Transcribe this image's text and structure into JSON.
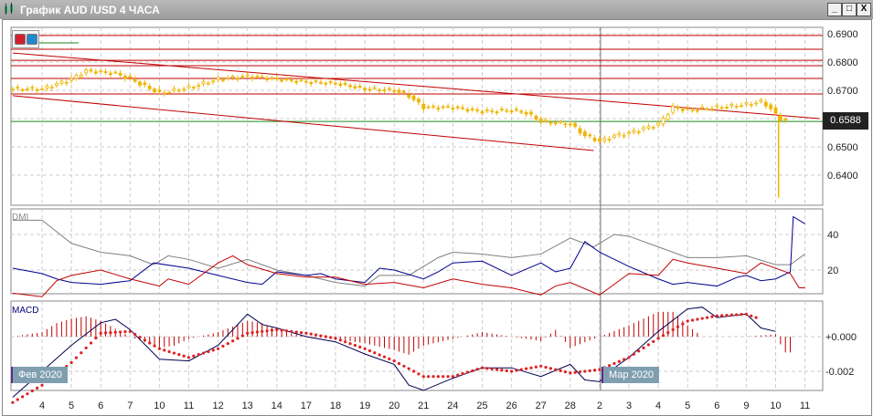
{
  "window": {
    "title": "График AUD /USD  4 ЧАСА",
    "minimize": "_",
    "maximize": "□",
    "close": "X"
  },
  "price_tag": "0.6588",
  "indicators": {
    "dmi": "DMI",
    "macd": "MACD"
  },
  "months": [
    "Фев 2020",
    "Мар 2020"
  ],
  "colors": {
    "candle": "#f0b400",
    "level": "#c00000",
    "green": "#1a8a1a",
    "adx": "#808080",
    "plus_di": "#000090",
    "minus_di": "#c00000",
    "macd": "#000050",
    "signal": "#e02020"
  },
  "chart_data": {
    "type": "line",
    "symbol": "AUD/USD",
    "timeframe": "4 ЧАСА",
    "x_ticks": [
      "4",
      "5",
      "6",
      "7",
      "10",
      "11",
      "12",
      "13",
      "14",
      "17",
      "18",
      "19",
      "20",
      "21",
      "24",
      "25",
      "26",
      "27",
      "28",
      "2",
      "3",
      "4",
      "5",
      "6",
      "9",
      "10",
      "11"
    ],
    "price": {
      "ylim": [
        0.632,
        0.6905
      ],
      "y_ticks": [
        "0.6900",
        "0.6800",
        "0.6700",
        "0.6500",
        "0.6400"
      ],
      "current": 0.6588,
      "close": [
        [
          -1,
          0.6705
        ],
        [
          0,
          0.6705
        ],
        [
          1,
          0.674
        ],
        [
          1.5,
          0.677
        ],
        [
          2,
          0.6765
        ],
        [
          2.5,
          0.676
        ],
        [
          3,
          0.674
        ],
        [
          4,
          0.669
        ],
        [
          4.5,
          0.67
        ],
        [
          5,
          0.671
        ],
        [
          6,
          0.674
        ],
        [
          7,
          0.675
        ],
        [
          8,
          0.674
        ],
        [
          9,
          0.673
        ],
        [
          10,
          0.6725
        ],
        [
          11,
          0.6705
        ],
        [
          12,
          0.67
        ],
        [
          12.5,
          0.668
        ],
        [
          13,
          0.664
        ],
        [
          14,
          0.664
        ],
        [
          15,
          0.6625
        ],
        [
          16,
          0.663
        ],
        [
          16.5,
          0.662
        ],
        [
          17,
          0.659
        ],
        [
          18,
          0.658
        ],
        [
          18.5,
          0.654
        ],
        [
          19,
          0.652
        ],
        [
          19.5,
          0.654
        ],
        [
          20,
          0.655
        ],
        [
          21,
          0.658
        ],
        [
          21.5,
          0.664
        ],
        [
          22,
          0.663
        ],
        [
          23,
          0.664
        ],
        [
          24,
          0.665
        ],
        [
          24.5,
          0.666
        ],
        [
          24.8,
          0.664
        ],
        [
          25.1,
          0.66
        ],
        [
          25.5,
          0.659
        ]
      ],
      "spike_low": [
        25.1,
        0.632
      ],
      "levels": [
        0.6894,
        0.6845,
        0.6806,
        0.6787,
        0.6742,
        0.6687
      ],
      "green_level": 0.659,
      "trendlines": [
        [
          [
            -1,
            0.6832
          ],
          [
            26.5,
            0.66
          ]
        ],
        [
          [
            -1,
            0.6681
          ],
          [
            18.8,
            0.6487
          ]
        ]
      ]
    },
    "dmi": {
      "ylim": [
        4,
        52
      ],
      "y_ticks": [
        "40",
        "20"
      ],
      "adx": [
        [
          -1,
          48
        ],
        [
          0,
          48
        ],
        [
          1,
          35
        ],
        [
          2,
          30
        ],
        [
          3,
          28
        ],
        [
          3.8,
          23
        ],
        [
          4.3,
          28
        ],
        [
          5,
          26
        ],
        [
          6,
          21
        ],
        [
          7,
          26
        ],
        [
          8,
          20
        ],
        [
          9,
          17
        ],
        [
          10,
          13
        ],
        [
          11,
          11
        ],
        [
          11.5,
          17
        ],
        [
          12.5,
          17
        ],
        [
          13.5,
          27
        ],
        [
          14,
          30
        ],
        [
          15,
          29
        ],
        [
          16,
          27
        ],
        [
          17,
          29
        ],
        [
          18,
          38
        ],
        [
          18.8,
          33
        ],
        [
          19.5,
          40
        ],
        [
          20,
          39
        ],
        [
          21,
          33
        ],
        [
          22,
          27
        ],
        [
          23,
          27
        ],
        [
          24,
          28
        ],
        [
          25,
          23
        ],
        [
          25.5,
          23
        ],
        [
          26,
          29
        ]
      ],
      "plus_di": [
        [
          -1,
          21
        ],
        [
          0,
          18
        ],
        [
          0.5,
          15
        ],
        [
          1,
          13
        ],
        [
          2,
          12
        ],
        [
          3,
          14
        ],
        [
          3.8,
          24
        ],
        [
          5,
          21
        ],
        [
          6,
          17
        ],
        [
          7,
          13
        ],
        [
          7.5,
          12
        ],
        [
          8,
          19
        ],
        [
          9,
          17
        ],
        [
          9.5,
          18
        ],
        [
          10,
          15
        ],
        [
          11,
          13
        ],
        [
          11.5,
          21
        ],
        [
          12,
          20
        ],
        [
          13,
          15
        ],
        [
          13.5,
          19
        ],
        [
          14,
          24
        ],
        [
          15,
          25
        ],
        [
          16,
          17
        ],
        [
          17,
          24
        ],
        [
          17.5,
          19
        ],
        [
          18,
          21
        ],
        [
          18.5,
          36
        ],
        [
          19,
          30
        ],
        [
          20,
          22
        ],
        [
          21,
          15
        ],
        [
          21.5,
          12
        ],
        [
          22,
          13
        ],
        [
          23,
          11
        ],
        [
          23.7,
          16
        ],
        [
          24,
          17
        ],
        [
          24.5,
          14
        ],
        [
          25,
          15
        ],
        [
          25.5,
          19
        ],
        [
          25.6,
          50
        ],
        [
          26,
          46
        ]
      ],
      "minus_di": [
        [
          -1,
          7
        ],
        [
          0,
          5
        ],
        [
          0.5,
          14
        ],
        [
          1,
          17
        ],
        [
          2,
          20
        ],
        [
          3,
          15
        ],
        [
          4,
          11
        ],
        [
          4.3,
          15
        ],
        [
          5,
          12
        ],
        [
          6,
          24
        ],
        [
          6.5,
          28
        ],
        [
          7,
          23
        ],
        [
          8,
          18
        ],
        [
          9,
          16
        ],
        [
          10,
          16
        ],
        [
          11,
          12
        ],
        [
          12,
          13
        ],
        [
          13,
          10
        ],
        [
          14,
          15
        ],
        [
          15,
          12
        ],
        [
          16,
          10
        ],
        [
          17,
          6
        ],
        [
          17.5,
          11
        ],
        [
          18,
          13
        ],
        [
          19,
          6
        ],
        [
          19.5,
          12
        ],
        [
          20,
          18
        ],
        [
          21,
          17
        ],
        [
          21.5,
          26
        ],
        [
          22,
          24
        ],
        [
          23,
          21
        ],
        [
          24,
          18
        ],
        [
          24.5,
          24
        ],
        [
          25,
          21
        ],
        [
          25.5,
          18
        ],
        [
          25.8,
          10
        ],
        [
          26,
          10
        ]
      ]
    },
    "macd": {
      "unit": 0.001,
      "ylim": [
        -3.2,
        1.9
      ],
      "y_ticks": [
        "+0.000",
        "-0.002"
      ],
      "main": [
        [
          -1,
          -3.5
        ],
        [
          0,
          -2
        ],
        [
          1,
          -0.5
        ],
        [
          2,
          0.8
        ],
        [
          2.5,
          1
        ],
        [
          3,
          0.4
        ],
        [
          4,
          -1.3
        ],
        [
          5,
          -1.4
        ],
        [
          6,
          -0.5
        ],
        [
          7,
          1.3
        ],
        [
          7.5,
          0.7
        ],
        [
          8,
          0.5
        ],
        [
          9,
          0
        ],
        [
          10,
          -0.3
        ],
        [
          11,
          -1
        ],
        [
          12,
          -1.6
        ],
        [
          12.5,
          -2.8
        ],
        [
          13,
          -3.1
        ],
        [
          14,
          -2.4
        ],
        [
          15,
          -1.8
        ],
        [
          16,
          -1.8
        ],
        [
          17,
          -2.3
        ],
        [
          18,
          -1.6
        ],
        [
          18.5,
          -2.5
        ],
        [
          19,
          -2.6
        ],
        [
          19.5,
          -1.8
        ],
        [
          20,
          -1.2
        ],
        [
          21,
          0.3
        ],
        [
          22,
          1.6
        ],
        [
          22.5,
          1.7
        ],
        [
          23,
          1.1
        ],
        [
          24,
          1.3
        ],
        [
          24.5,
          0.5
        ],
        [
          25,
          0.3
        ]
      ],
      "signal": [
        [
          -1,
          -3.8
        ],
        [
          0,
          -2.8
        ],
        [
          1,
          -1.5
        ],
        [
          2,
          0.2
        ],
        [
          3,
          0.3
        ],
        [
          4,
          -0.7
        ],
        [
          5,
          -1.2
        ],
        [
          6,
          -0.7
        ],
        [
          7,
          0.2
        ],
        [
          8,
          0.4
        ],
        [
          9,
          0.2
        ],
        [
          10,
          -0.1
        ],
        [
          11,
          -0.7
        ],
        [
          12,
          -1.4
        ],
        [
          13,
          -2.3
        ],
        [
          14,
          -2.3
        ],
        [
          15,
          -1.8
        ],
        [
          16,
          -2
        ],
        [
          17,
          -1.7
        ],
        [
          18,
          -2.1
        ],
        [
          19,
          -1.9
        ],
        [
          20,
          -1.2
        ],
        [
          21,
          -0.1
        ],
        [
          22,
          0.9
        ],
        [
          23,
          1.2
        ],
        [
          24,
          1.3
        ],
        [
          24.5,
          1.0
        ]
      ],
      "histogram": [
        [
          -1,
          0
        ],
        [
          0,
          0.2
        ],
        [
          0.5,
          0.6
        ],
        [
          1,
          0.8
        ],
        [
          1.5,
          0.9
        ],
        [
          2,
          0.7
        ],
        [
          3,
          0
        ],
        [
          4,
          -0.5
        ],
        [
          4.5,
          -0.4
        ],
        [
          5,
          -0.1
        ],
        [
          6,
          0.2
        ],
        [
          7,
          0.7
        ],
        [
          7.5,
          0.6
        ],
        [
          8,
          0.3
        ],
        [
          9,
          0
        ],
        [
          10,
          -0.1
        ],
        [
          11,
          -0.3
        ],
        [
          12,
          -0.6
        ],
        [
          12.5,
          -0.8
        ],
        [
          13,
          -0.4
        ],
        [
          14,
          -0.1
        ],
        [
          15,
          0.2
        ],
        [
          16,
          0
        ],
        [
          17,
          -0.2
        ],
        [
          17.5,
          0.3
        ],
        [
          18,
          -0.5
        ],
        [
          19,
          0
        ],
        [
          20,
          0.5
        ],
        [
          21,
          1.1
        ],
        [
          21.5,
          1.1
        ],
        [
          22,
          0.5
        ],
        [
          22.5,
          0
        ],
        [
          24,
          0
        ],
        [
          25,
          0.1
        ],
        [
          25.3,
          -0.7
        ],
        [
          25.6,
          -0.7
        ]
      ]
    }
  }
}
